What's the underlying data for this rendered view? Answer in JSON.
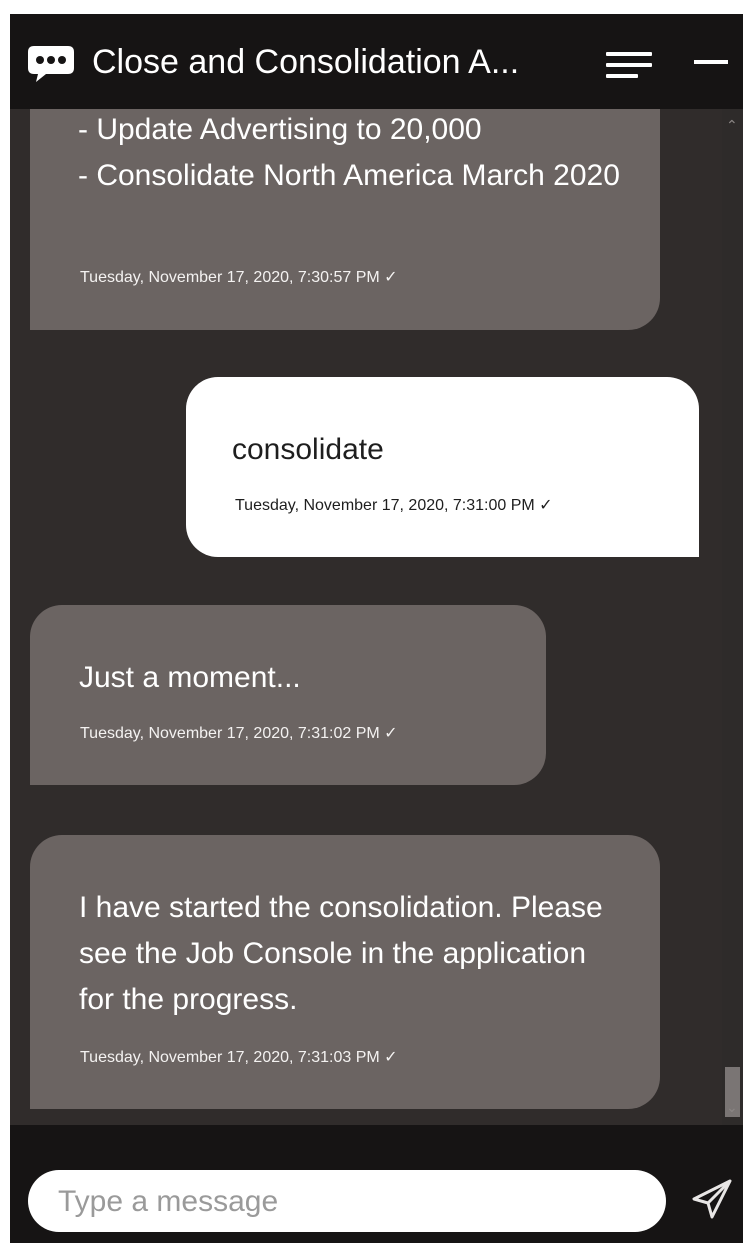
{
  "header": {
    "title": "Close and Consolidation A...",
    "chat_icon": "speech-bubble-icon",
    "menu_icon": "hamburger-menu-icon",
    "minimize_icon": "minimize-icon"
  },
  "messages": [
    {
      "sender": "bot",
      "text": "  - Update Advertising to 20,000\n  - Consolidate North America March 2020",
      "timestamp": "Tuesday, November 17, 2020, 7:30:57 PM ✓"
    },
    {
      "sender": "user",
      "text": "consolidate",
      "timestamp": "Tuesday, November 17, 2020, 7:31:00 PM ✓"
    },
    {
      "sender": "bot",
      "text": "Just a moment...",
      "timestamp": "Tuesday, November 17, 2020, 7:31:02 PM ✓"
    },
    {
      "sender": "bot",
      "text": "I have started the consolidation. Please see the Job Console in the application for the progress.",
      "timestamp": "Tuesday, November 17, 2020, 7:31:03 PM ✓"
    }
  ],
  "input": {
    "placeholder": "Type a message",
    "value": ""
  },
  "send_icon": "send-paper-plane-icon",
  "colors": {
    "header_bg": "#161414",
    "chat_bg": "#302c2b",
    "bot_bubble": "#6b6462",
    "user_bubble": "#ffffff"
  }
}
